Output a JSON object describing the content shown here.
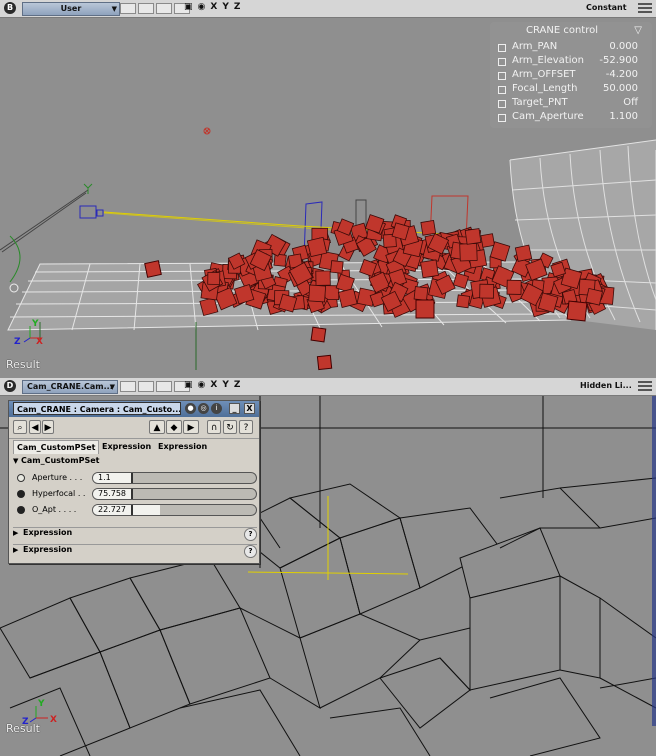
{
  "viewport_top": {
    "letter": "B",
    "view_name": "User",
    "axes": [
      "X",
      "Y",
      "Z"
    ],
    "mode": "Constant",
    "label": "Result",
    "hud": {
      "title": "CRANE  control",
      "toggle_icon": "▽",
      "rows": [
        {
          "name": "Arm_PAN",
          "value": "0.000"
        },
        {
          "name": "Arm_Elevation",
          "value": "-52.900"
        },
        {
          "name": "Arm_OFFSET",
          "value": "-4.200"
        },
        {
          "name": "Focal_Length",
          "value": "50.000"
        },
        {
          "name": "Target_PNT",
          "value": "Off"
        },
        {
          "name": "Cam_Aperture",
          "value": "1.100"
        }
      ]
    }
  },
  "viewport_bottom": {
    "letter": "D",
    "view_name": "Cam_CRANE.Cam...",
    "axes": [
      "X",
      "Y",
      "Z"
    ],
    "mode": "Hidden Li...",
    "label": "Result"
  },
  "property_panel": {
    "title": "Cam_CRANE : Camera : Cam_Custo...",
    "tabs": [
      "Cam_CustomPSet",
      "Expression",
      "Expression"
    ],
    "section": "Cam_CustomPSet",
    "params": [
      {
        "label": "Aperture . . .",
        "value": "1.1",
        "fill": 0.0,
        "icon": "ring"
      },
      {
        "label": "Hyperfocal . .",
        "value": "75.758",
        "fill": 0.0,
        "icon": "dot"
      },
      {
        "label": "O_Apt . . . .",
        "value": "22.727",
        "fill": 0.22,
        "icon": "dot"
      }
    ],
    "expressions": [
      "Expression",
      "Expression"
    ]
  },
  "colors": {
    "viewport_bg": "#8f8f8f",
    "cube": "#c0362c",
    "grid": "#e6e6e6",
    "cam_line": "#e0d000",
    "panel_bg": "#d4d0c8"
  }
}
